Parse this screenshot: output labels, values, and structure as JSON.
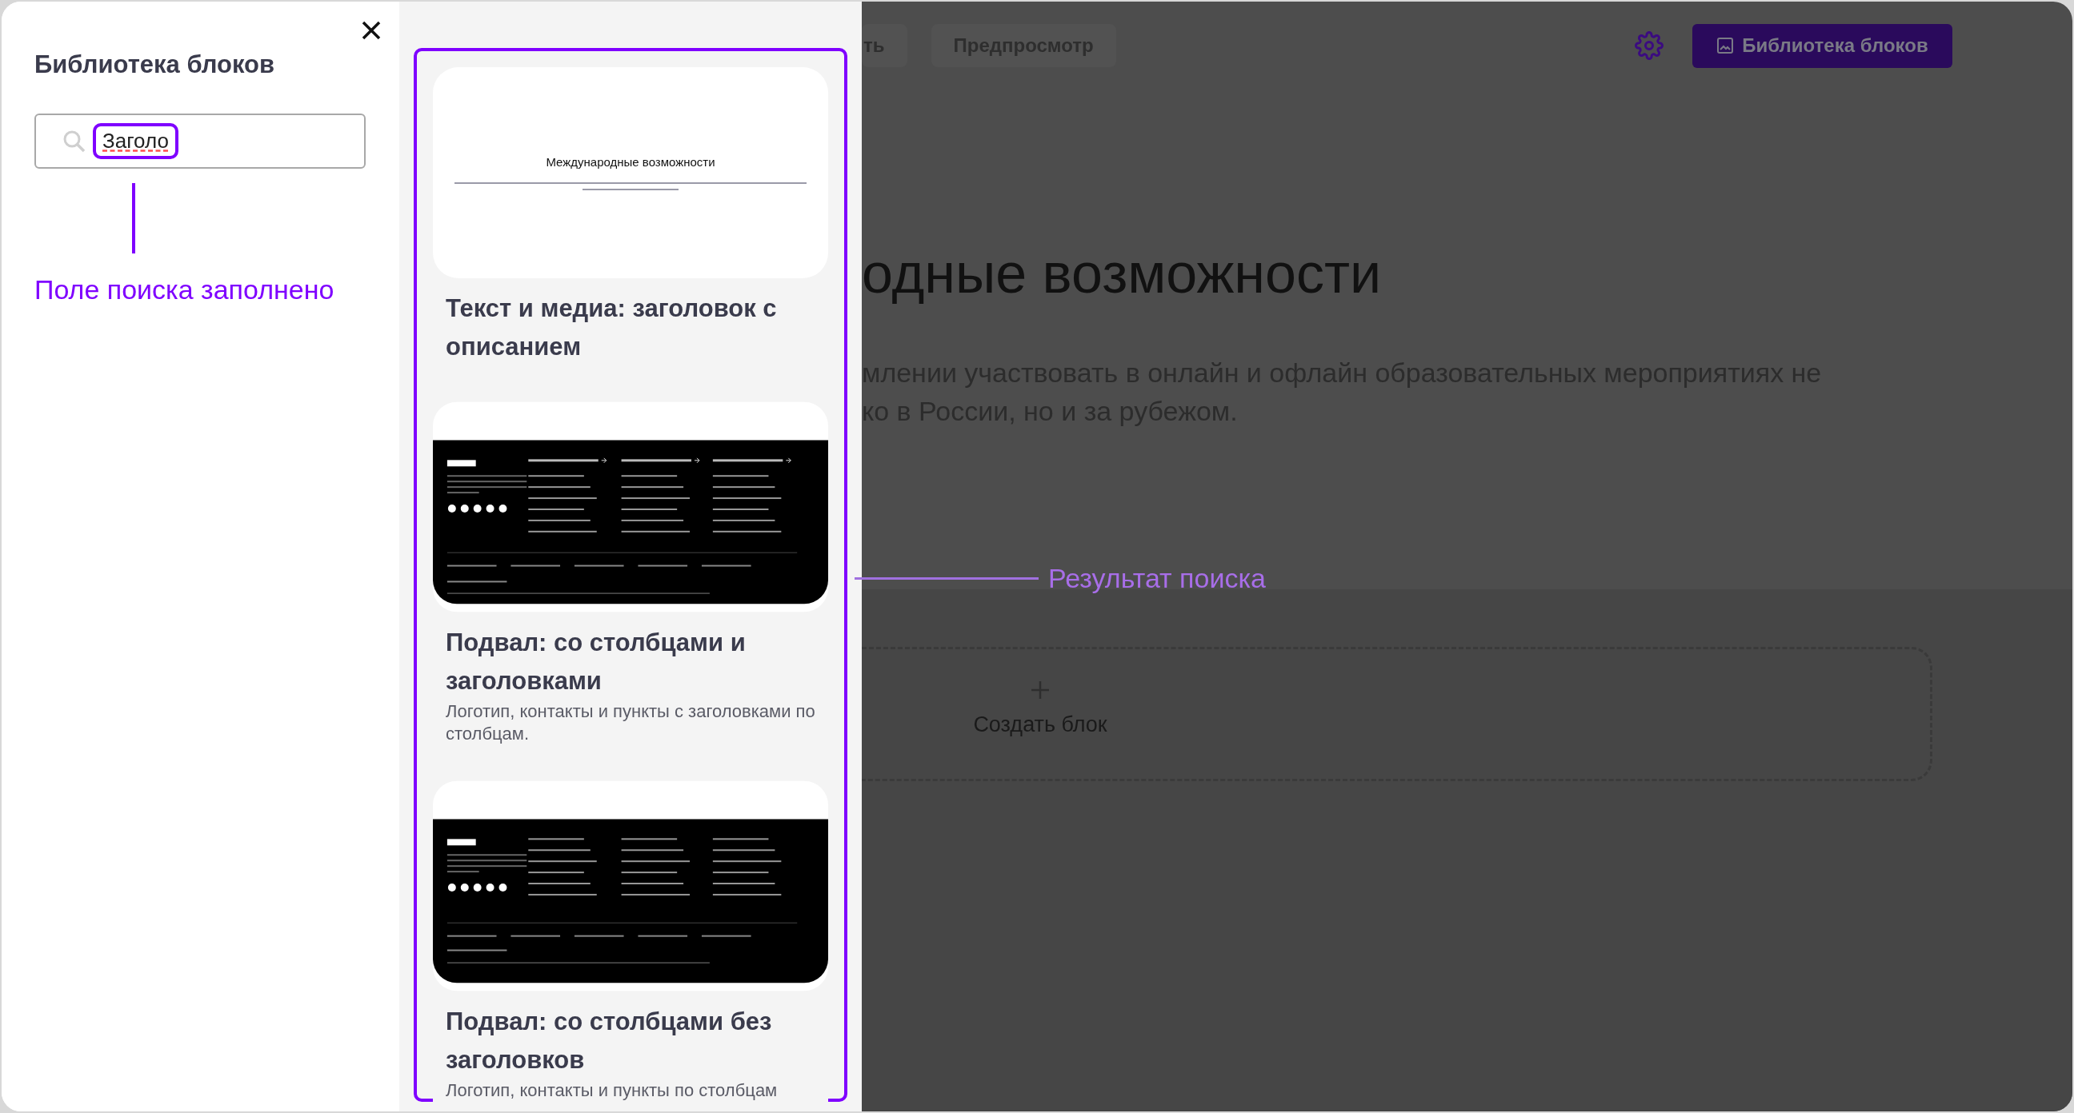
{
  "library_panel": {
    "title": "Библиотека блоков",
    "search": {
      "value": "Заголо"
    }
  },
  "results": [
    {
      "kind": "text-media",
      "preview_heading": "Международные возможности",
      "title": "Текст и медиа: заголовок с описанием"
    },
    {
      "kind": "footer-headed",
      "title": "Подвал: со столбцами и заголовками",
      "description": "Логотип, контакты и пункты с заголовками по столбцам."
    },
    {
      "kind": "footer-plain",
      "title": "Подвал: со столбцами без заголовков",
      "description": "Логотип, контакты и пункты по столбцам"
    }
  ],
  "editor": {
    "toolbar_buttons": [
      "ть",
      "Предпросмотр"
    ],
    "library_button": "Библиотека блоков",
    "heading": "одные возможности",
    "paragraph_lines": [
      "млении участвовать в онлайн и офлайн образовательных мероприятиях не",
      "ко в России, но и за рубежом."
    ],
    "create_block": "Создать блок"
  },
  "annotations": [
    {
      "kind": "search-filled",
      "text": "Поле поиска заполнено"
    },
    {
      "kind": "search-result",
      "text": "Результат поиска"
    }
  ]
}
